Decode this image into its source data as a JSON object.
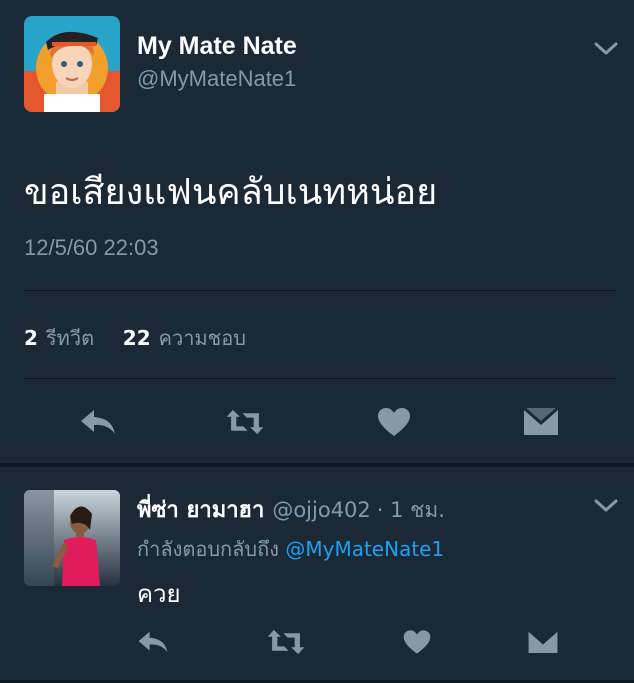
{
  "tweet": {
    "display_name": "My Mate Nate",
    "handle": "@MyMateNate1",
    "text": "ขอเสียงแฟนคลับเนทหน่อย",
    "timestamp": "12/5/60 22:03",
    "retweet_count": "2",
    "retweet_label": "รีทวีต",
    "like_count": "22",
    "like_label": "ความชอบ",
    "menu_icon": "chevron-down-icon",
    "actions": [
      "reply-icon",
      "retweet-icon",
      "heart-icon",
      "message-icon"
    ]
  },
  "reply": {
    "display_name": "พี่ซ่า ยามาฮา",
    "handle": "@ojjo402",
    "time": "· 1 ชม.",
    "replying_to_label": "กำลังตอบกลับถึง",
    "replying_to_handle": "@MyMateNate1",
    "text": "ควย",
    "menu_icon": "chevron-down-icon",
    "actions": [
      "reply-icon",
      "retweet-icon",
      "heart-icon",
      "message-icon"
    ]
  },
  "colors": {
    "background": "#1b2836",
    "muted": "#8899a6",
    "link": "#1da1f2",
    "icon": "#8899a6"
  }
}
